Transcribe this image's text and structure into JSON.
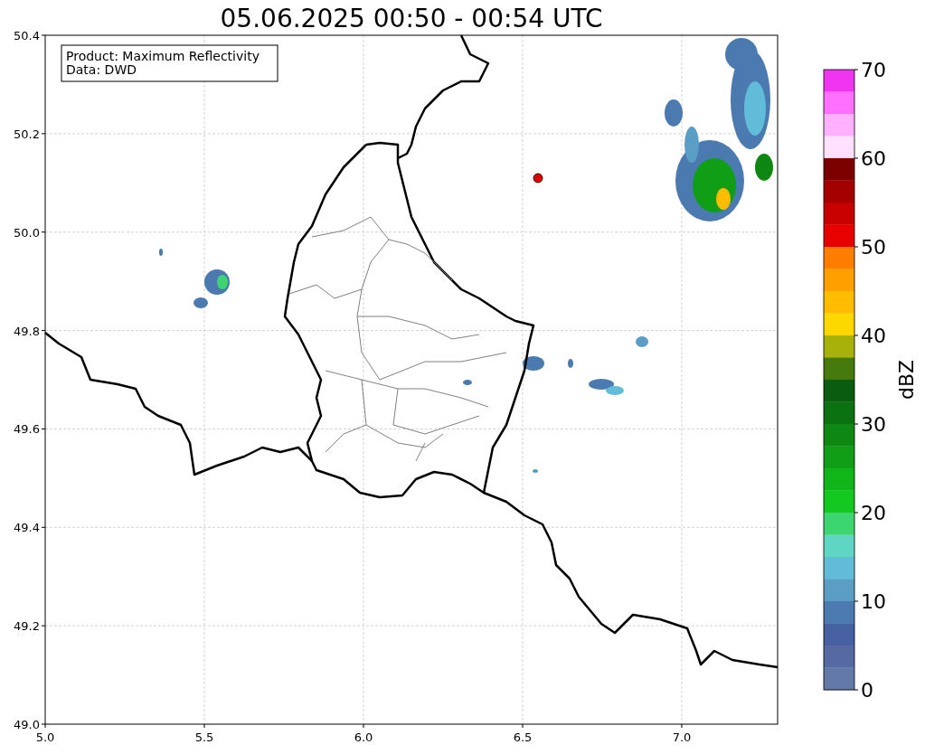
{
  "title": "05.06.2025 00:50 - 00:54 UTC",
  "info_box": [
    "Product: Maximum Reflectivity",
    "Data: DWD"
  ],
  "map": {
    "xticks": [
      "5.0",
      "5.5",
      "6.0",
      "6.5",
      "7.0"
    ],
    "yticks": [
      "50.4",
      "50.2",
      "50.0",
      "49.8",
      "49.6",
      "49.4",
      "49.2",
      "49.0"
    ]
  },
  "colorbar": {
    "label": "dBZ",
    "ticks": [
      "70",
      "60",
      "50",
      "40",
      "30",
      "20",
      "10",
      "0"
    ],
    "bands": [
      {
        "color": "#f035f0"
      },
      {
        "color": "#ff70ff"
      },
      {
        "color": "#ffb0ff"
      },
      {
        "color": "#ffe0ff"
      },
      {
        "color": "#7d0000"
      },
      {
        "color": "#a50000"
      },
      {
        "color": "#c80000"
      },
      {
        "color": "#e60000"
      },
      {
        "color": "#ff7e00"
      },
      {
        "color": "#ff9f00"
      },
      {
        "color": "#ffbc00"
      },
      {
        "color": "#ffd700"
      },
      {
        "color": "#a8b00a"
      },
      {
        "color": "#477a0c"
      },
      {
        "color": "#0a5d10"
      },
      {
        "color": "#0b7212"
      },
      {
        "color": "#0e8713"
      },
      {
        "color": "#0f9e16"
      },
      {
        "color": "#10b51a"
      },
      {
        "color": "#13c91f"
      },
      {
        "color": "#3dd56f"
      },
      {
        "color": "#5fd6c4"
      },
      {
        "color": "#60bcd8"
      },
      {
        "color": "#5a9ec6"
      },
      {
        "color": "#4a7aaf"
      },
      {
        "color": "#4760a2"
      },
      {
        "color": "#5669a3"
      },
      {
        "color": "#6379a8"
      }
    ]
  }
}
